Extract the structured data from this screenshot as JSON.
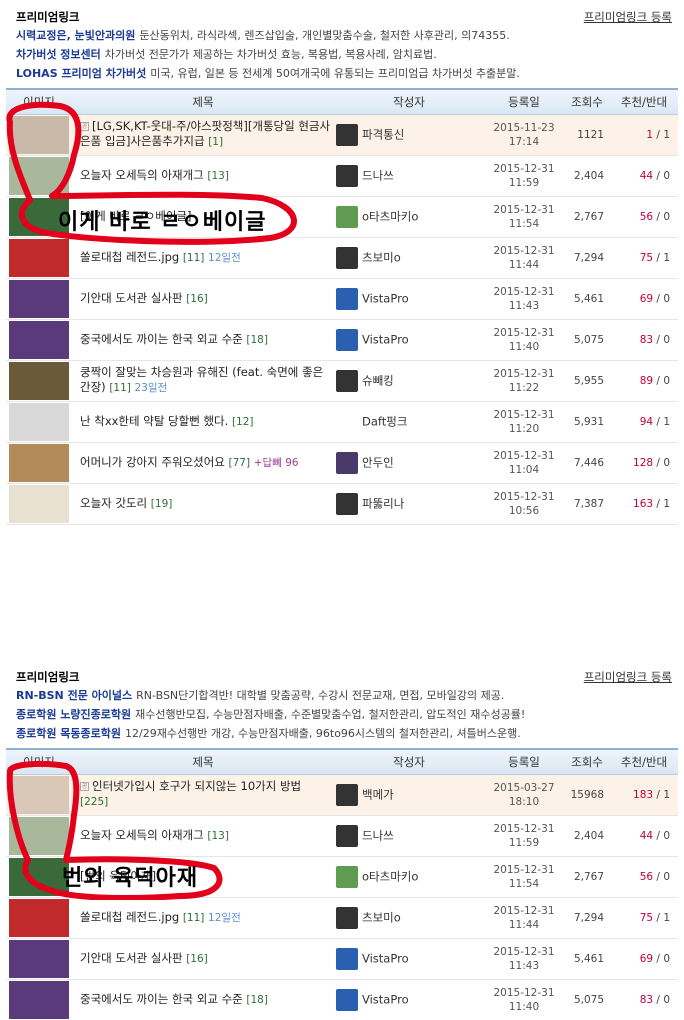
{
  "colors": {
    "accent": "#1a3a94",
    "recommend": "#c0003c",
    "header_bg": "#dbe8f4",
    "notice_bg": "#fdf2e7",
    "red_marker": "#e3001b"
  },
  "panel1": {
    "ads": {
      "title": "프리미엄링크",
      "register": "프리미엄링크 등록",
      "lines": [
        {
          "name": "시력교정은, 눈빛안과의원",
          "desc": "둔산동위치, 라식라섹, 렌즈삽입술, 개인별맞춤수술, 철저한 사후관리, 의74355."
        },
        {
          "name": "차가버섯 정보센터",
          "desc": "차가버섯 전문가가 제공하는 차가버섯 효능, 복용법, 복용사례, 암치료법."
        },
        {
          "name": "LOHAS 프리미엄 차가버섯",
          "desc": "미국, 유럽, 일본 등 전세계 50여개국에 유통되는 프리미엄급 차가버섯 추출분말."
        }
      ]
    },
    "headers": [
      "이미지",
      "제목",
      "작성자",
      "등록일",
      "조회수",
      "추천/반대"
    ],
    "rows": [
      {
        "notice": true,
        "title": "[LG,SK,KT-웃대-주/야스팟정책][개통당일 현금사은품 입금]사은품추가지급",
        "cc": "[1]",
        "ago": "",
        "reply": "",
        "author": "파격통신",
        "date": "2015-11-23",
        "time": "17:14",
        "hits": "1121",
        "rec": "1",
        "opp": "1",
        "thumb": "#c9b9a8",
        "avatar": "#333333"
      },
      {
        "notice": false,
        "title": "오늘자 오세득의 아재개그",
        "cc": "[13]",
        "ago": "",
        "reply": "",
        "author": "드나쓰",
        "date": "2015-12-31",
        "time": "11:59",
        "hits": "2,404",
        "rec": "44",
        "opp": "0",
        "thumb": "#a9b89a",
        "avatar": "#333333"
      },
      {
        "notice": false,
        "title": "[이게 바로 ㄹㅇ베이글]",
        "cc": "",
        "ago": "",
        "reply": "",
        "author": "o타츠마키o",
        "date": "2015-12-31",
        "time": "11:54",
        "hits": "2,767",
        "rec": "56",
        "opp": "0",
        "thumb": "#3a6a3a",
        "avatar": "#5f9c52"
      },
      {
        "notice": false,
        "title": "쏠로대첩 레전드.jpg",
        "cc": "[11]",
        "ago": "12일전",
        "reply": "",
        "author": "츠보미o",
        "date": "2015-12-31",
        "time": "11:44",
        "hits": "7,294",
        "rec": "75",
        "opp": "1",
        "thumb": "#c02a2a",
        "avatar": "#333333"
      },
      {
        "notice": false,
        "title": "기안대 도서관 실사판",
        "cc": "[16]",
        "ago": "",
        "reply": "",
        "author": "VistaPro",
        "date": "2015-12-31",
        "time": "11:43",
        "hits": "5,461",
        "rec": "69",
        "opp": "0",
        "thumb": "#5a3a7a",
        "avatar": "#2b5fb0"
      },
      {
        "notice": false,
        "title": "중국에서도 까이는 한국 외교 수준",
        "cc": "[18]",
        "ago": "",
        "reply": "",
        "author": "VistaPro",
        "date": "2015-12-31",
        "time": "11:40",
        "hits": "5,075",
        "rec": "83",
        "opp": "0",
        "thumb": "#5a3a7a",
        "avatar": "#2b5fb0"
      },
      {
        "notice": false,
        "title": "쿵짝이 잘맞는 차승원과 유해진 (feat. 숙면에 좋은 간장)",
        "cc": "[11]",
        "ago": "23일전",
        "reply": "",
        "author": "슈빼킹",
        "date": "2015-12-31",
        "time": "11:22",
        "hits": "5,955",
        "rec": "89",
        "opp": "0",
        "thumb": "#6b5a3a",
        "avatar": "#333333"
      },
      {
        "notice": false,
        "title": "난 착xx한테 약탈 당할뻔 했다.",
        "cc": "[12]",
        "ago": "",
        "reply": "",
        "author": "Daft펑크",
        "date": "2015-12-31",
        "time": "11:20",
        "hits": "5,931",
        "rec": "94",
        "opp": "1",
        "thumb": "#d8d8d8",
        "avatar": "#ffffff"
      },
      {
        "notice": false,
        "title": "어머니가 강아지 주워오셨어요",
        "cc": "[77]",
        "ago": "",
        "reply": "+답뼤 96",
        "author": "안두인",
        "date": "2015-12-31",
        "time": "11:04",
        "hits": "7,446",
        "rec": "128",
        "opp": "0",
        "thumb": "#b58a5a",
        "avatar": "#4a3a6a"
      },
      {
        "notice": false,
        "title": "오늘자 갓도리",
        "cc": "[19]",
        "ago": "",
        "reply": "",
        "author": "파뚫리나",
        "date": "2015-12-31",
        "time": "10:56",
        "hits": "7,387",
        "rec": "163",
        "opp": "1",
        "thumb": "#e8e0d0",
        "avatar": "#333333"
      }
    ],
    "caption": "이게 바로 ㄹㅇ베이글"
  },
  "panel2": {
    "ads": {
      "title": "프리미엄링크",
      "register": "프리미엄링크 등록",
      "lines": [
        {
          "name": "RN-BSN 전문 아이널스",
          "desc": "RN-BSN단기합격반! 대학별 맞춤공략, 수강시 전문교재, 면접, 모바일강의 제공."
        },
        {
          "name": "종로학원 노량진종로학원",
          "desc": "재수선행반모집, 수능만점자배출, 수준별맞춤수업, 철저한관리, 압도적인 재수성공률!"
        },
        {
          "name": "종로학원 목동종로학원",
          "desc": "12/29재수선행반 개강, 수능만점자배출, 96to96시스템의 철저한관리, 셔틀버스운행."
        }
      ]
    },
    "headers": [
      "이미지",
      "제목",
      "작성자",
      "등록일",
      "조회수",
      "추천/반대"
    ],
    "rows": [
      {
        "notice": true,
        "title": "인터넷가입시 호구가 되지않는 10가지 방법",
        "cc": "[225]",
        "ago": "",
        "reply": "",
        "author": "백메가",
        "date": "2015-03-27",
        "time": "18:10",
        "hits": "15968",
        "rec": "183",
        "opp": "1",
        "thumb": "#d9c8b8",
        "avatar": "#333333"
      },
      {
        "notice": false,
        "title": "오늘자 오세득의 아재개그",
        "cc": "[13]",
        "ago": "",
        "reply": "",
        "author": "드나쓰",
        "date": "2015-12-31",
        "time": "11:59",
        "hits": "2,404",
        "rec": "44",
        "opp": "0",
        "thumb": "#a9b89a",
        "avatar": "#333333"
      },
      {
        "notice": false,
        "title": "[번외 육덕아재]",
        "cc": "",
        "ago": "",
        "reply": "",
        "author": "o타츠마키o",
        "date": "2015-12-31",
        "time": "11:54",
        "hits": "2,767",
        "rec": "56",
        "opp": "0",
        "thumb": "#3a6a3a",
        "avatar": "#5f9c52"
      },
      {
        "notice": false,
        "title": "쏠로대첩 레전드.jpg",
        "cc": "[11]",
        "ago": "12일전",
        "reply": "",
        "author": "츠보미o",
        "date": "2015-12-31",
        "time": "11:44",
        "hits": "7,294",
        "rec": "75",
        "opp": "1",
        "thumb": "#c02a2a",
        "avatar": "#333333"
      },
      {
        "notice": false,
        "title": "기안대 도서관 실사판",
        "cc": "[16]",
        "ago": "",
        "reply": "",
        "author": "VistaPro",
        "date": "2015-12-31",
        "time": "11:43",
        "hits": "5,461",
        "rec": "69",
        "opp": "0",
        "thumb": "#5a3a7a",
        "avatar": "#2b5fb0"
      },
      {
        "notice": false,
        "title": "중국에서도 까이는 한국 외교 수준",
        "cc": "[18]",
        "ago": "",
        "reply": "",
        "author": "VistaPro",
        "date": "2015-12-31",
        "time": "11:40",
        "hits": "5,075",
        "rec": "83",
        "opp": "0",
        "thumb": "#5a3a7a",
        "avatar": "#2b5fb0"
      }
    ],
    "caption": "번외 육덕아재"
  }
}
